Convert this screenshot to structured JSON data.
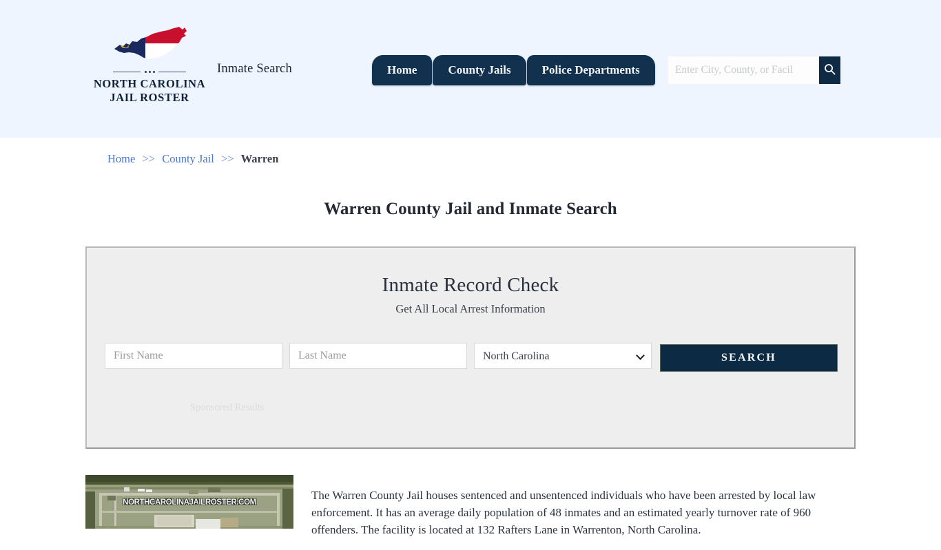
{
  "colors": {
    "header_bg": "#eef5ff",
    "navy": "#12314f",
    "button_navy": "#0d2a45",
    "link_blue": "#4a77cf",
    "panel_bg": "#eeeeee",
    "flag_red": "#c8102e",
    "flag_navy": "#1b2a5e",
    "flag_gold": "#d6b12a"
  },
  "header": {
    "logo": {
      "map_icon": "north-carolina-state-map-icon",
      "line1": "NORTH CAROLINA",
      "line2": "JAIL ROSTER"
    },
    "tagline": "Inmate Search",
    "nav": [
      {
        "label": "Home"
      },
      {
        "label": "County Jails"
      },
      {
        "label": "Police Departments"
      }
    ],
    "search": {
      "placeholder": "Enter City, County, or Facil",
      "value": "",
      "icon": "search-icon"
    }
  },
  "breadcrumb": {
    "items": [
      {
        "label": "Home",
        "link": true
      },
      {
        "label": "County Jail",
        "link": true
      },
      {
        "label": "Warren",
        "link": false
      }
    ],
    "separator": ">>"
  },
  "page_title": "Warren County Jail and Inmate Search",
  "record_check": {
    "title": "Inmate Record Check",
    "subtitle": "Get All Local Arrest Information",
    "first_name": {
      "placeholder": "First Name",
      "value": ""
    },
    "last_name": {
      "placeholder": "Last Name",
      "value": ""
    },
    "state": {
      "selected": "North Carolina",
      "icon": "chevron-down-icon"
    },
    "search_button": "SEARCH",
    "sponsored_label": "Sponsored Results"
  },
  "article": {
    "image": {
      "alt": "aerial-satellite-view-of-warren-county-jail",
      "watermark": "NORTHCAROLINAJAILROSTER.COM"
    },
    "paragraph": "The Warren County Jail houses sentenced and unsentenced individuals who have been arrested by local law enforcement. It has an average daily population of 48 inmates and an estimated yearly turnover rate of 960 offenders. The facility is located at 132 Rafters Lane in Warrenton, North Carolina."
  }
}
